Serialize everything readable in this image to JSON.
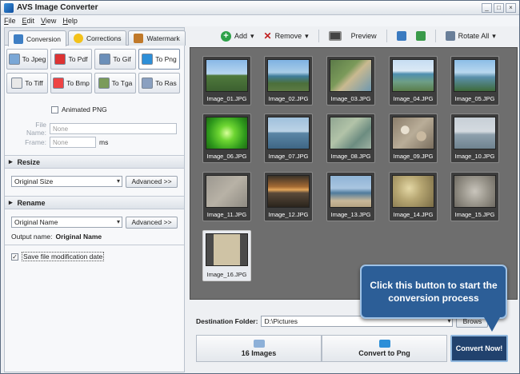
{
  "window": {
    "title": "AVS Image Converter"
  },
  "menu": [
    "File",
    "Edit",
    "View",
    "Help"
  ],
  "tabs": [
    "Conversion",
    "Corrections",
    "Watermark"
  ],
  "formats": [
    "To Jpeg",
    "To Pdf",
    "To Gif",
    "To Png",
    "To Tiff",
    "To Bmp",
    "To Tga",
    "To Ras"
  ],
  "selected_format": "To Png",
  "options": {
    "animated_label": "Animated PNG",
    "filename_label": "File Name:",
    "filename_placeholder": "None",
    "frame_label": "Frame:",
    "frame_value": "None",
    "frame_unit": "ms"
  },
  "resize": {
    "header": "Resize",
    "value": "Original Size",
    "advanced": "Advanced >>"
  },
  "rename": {
    "header": "Rename",
    "value": "Original Name",
    "advanced": "Advanced >>",
    "output_label": "Output name:",
    "output_value": "Original Name"
  },
  "save_date_label": "Save file modification date",
  "toolbar": {
    "add": "Add",
    "remove": "Remove",
    "preview": "Preview",
    "rotate_all": "Rotate All"
  },
  "images": [
    "Image_01.JPG",
    "Image_02.JPG",
    "Image_03.JPG",
    "Image_04.JPG",
    "Image_05.JPG",
    "Image_06.JPG",
    "Image_07.JPG",
    "Image_08.JPG",
    "Image_09.JPG",
    "Image_10.JPG",
    "Image_11.JPG",
    "Image_12.JPG",
    "Image_13.JPG",
    "Image_14.JPG",
    "Image_15.JPG",
    "Image_16.JPG"
  ],
  "destination": {
    "label": "Destination Folder:",
    "value": "D:\\Pictures",
    "browse": "Brows"
  },
  "steps": {
    "count": "16 Images",
    "convert_to": "Convert to Png"
  },
  "convert_button": "Convert Now!",
  "callout": "Click this button to start the conversion process",
  "colors": {
    "gallery_bg": "#6e6e6e",
    "callout_bg": "#2c5e97",
    "convert_bg": "#21426e"
  }
}
